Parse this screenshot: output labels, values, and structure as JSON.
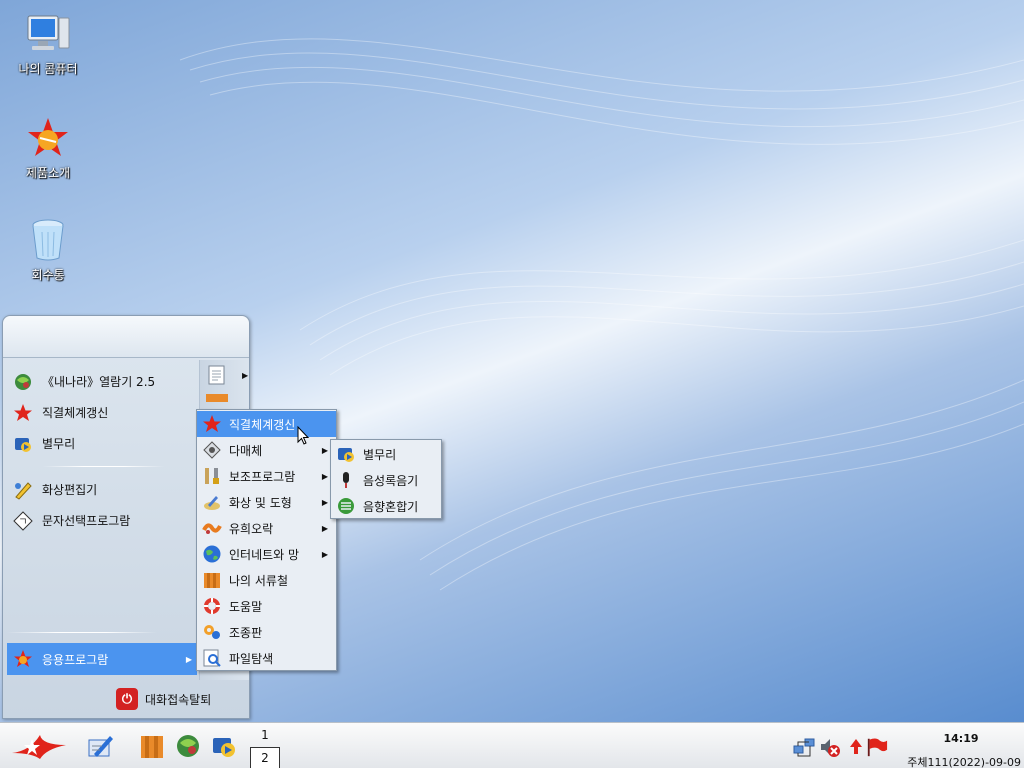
{
  "desktop": {
    "icons": [
      {
        "label": "나의 콤퓨터",
        "icon": "computer-icon"
      },
      {
        "label": "제품소개",
        "icon": "product-intro-icon"
      },
      {
        "label": "회수통",
        "icon": "trash-icon"
      }
    ]
  },
  "start_menu": {
    "left_items": [
      {
        "label": "《내나라》열람기 2.5",
        "icon": "browser-globe-icon"
      },
      {
        "label": "직결체계갱신",
        "icon": "system-update-star-icon"
      },
      {
        "label": "별무리",
        "icon": "media-player-icon"
      },
      {
        "label": "화상편집기",
        "icon": "image-editor-icon"
      },
      {
        "label": "문자선택프로그람",
        "icon": "character-map-icon"
      }
    ],
    "apps_label": "응용프로그람",
    "logout_label": "대화접속탈퇴"
  },
  "submenu_apps": [
    {
      "label": "직결체계갱신",
      "icon": "system-update-star-icon",
      "highlighted": true,
      "has_submenu": false
    },
    {
      "label": "다매체",
      "icon": "multimedia-icon",
      "highlighted": false,
      "has_submenu": true
    },
    {
      "label": "보조프로그람",
      "icon": "accessories-icon",
      "highlighted": false,
      "has_submenu": true
    },
    {
      "label": "화상 및 도형",
      "icon": "graphics-icon",
      "highlighted": false,
      "has_submenu": true
    },
    {
      "label": "유희오락",
      "icon": "games-icon",
      "highlighted": false,
      "has_submenu": true
    },
    {
      "label": "인터네트와 망",
      "icon": "internet-globe-icon",
      "highlighted": false,
      "has_submenu": true
    },
    {
      "label": "나의 서류철",
      "icon": "my-documents-icon",
      "highlighted": false,
      "has_submenu": false
    },
    {
      "label": "도움말",
      "icon": "help-lifebuoy-icon",
      "highlighted": false,
      "has_submenu": false
    },
    {
      "label": "조종판",
      "icon": "control-panel-icon",
      "highlighted": false,
      "has_submenu": false
    },
    {
      "label": "파일탐색",
      "icon": "file-search-icon",
      "highlighted": false,
      "has_submenu": false
    }
  ],
  "submenu_multimedia": [
    {
      "label": "별무리",
      "icon": "media-player-icon"
    },
    {
      "label": "음성록음기",
      "icon": "microphone-icon"
    },
    {
      "label": "음향혼합기",
      "icon": "mixer-icon"
    }
  ],
  "taskbar": {
    "workspaces": [
      "1",
      "2"
    ],
    "clock_time": "14:19",
    "clock_date": "주체111(2022)-09-09"
  },
  "colors": {
    "highlight": "#4b94ef",
    "desktop_blue": "#4f86cc"
  }
}
